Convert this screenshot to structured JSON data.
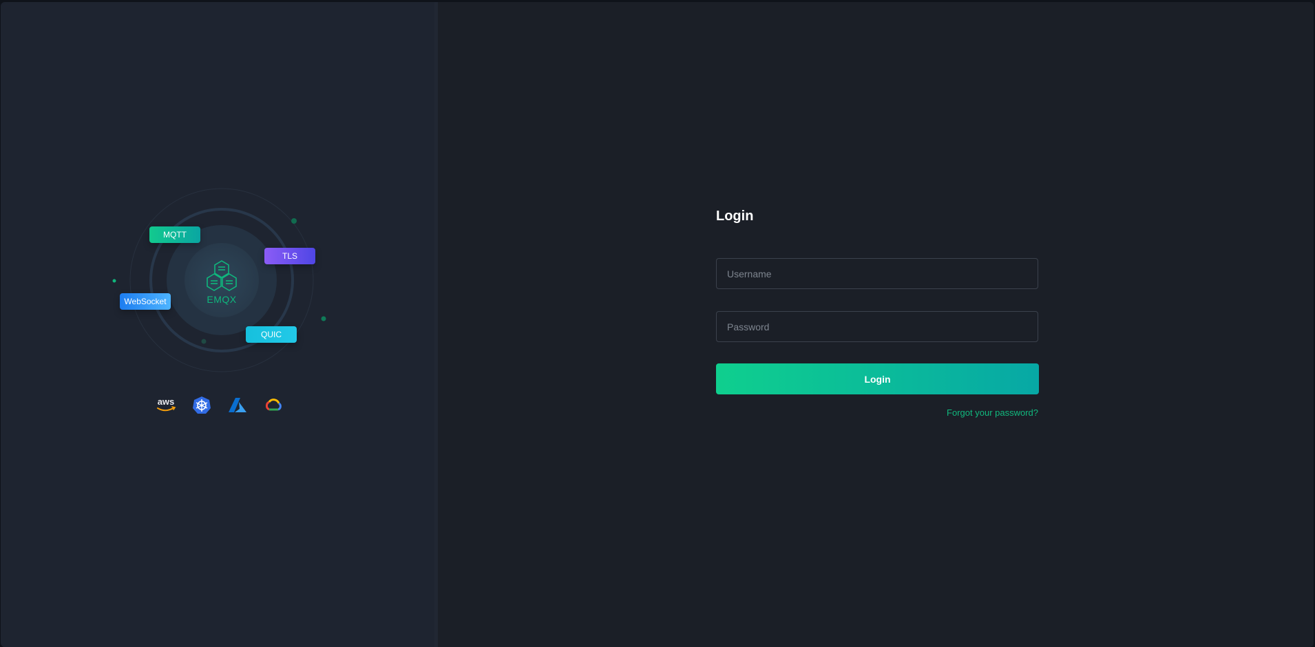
{
  "illustration": {
    "protocols": {
      "mqtt": "MQTT",
      "tls": "TLS",
      "websocket": "WebSocket",
      "quic": "QUIC"
    },
    "brand": "EMQX",
    "cloud_logos": [
      "aws-logo-icon",
      "kubernetes-icon",
      "azure-icon",
      "google-cloud-icon"
    ]
  },
  "login": {
    "title": "Login",
    "username_placeholder": "Username",
    "password_placeholder": "Password",
    "username_value": "",
    "password_value": "",
    "submit_label": "Login",
    "forgot_label": "Forgot your password?"
  },
  "colors": {
    "accent": "#0fcf8e",
    "accent_end": "#07a8a5",
    "link": "#11b97e",
    "left_bg": "#1e2430",
    "right_bg": "#1b1f27"
  }
}
